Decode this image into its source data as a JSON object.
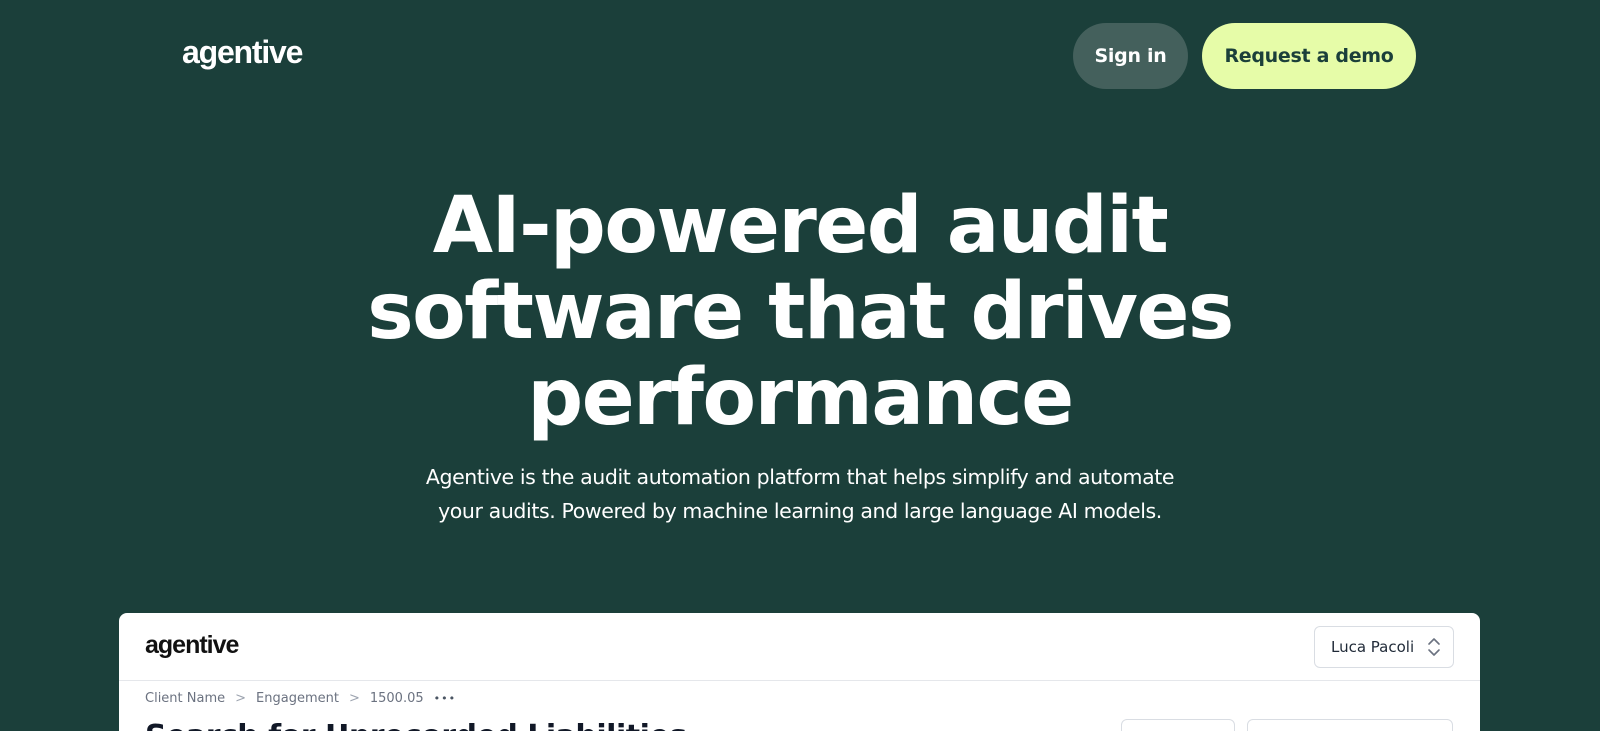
{
  "nav": {
    "logo": "agentive",
    "signin_label": "Sign in",
    "demo_label": "Request a demo"
  },
  "hero": {
    "title_line1": "AI-powered audit",
    "title_line2": "software that drives",
    "title_line3": "performance",
    "subtitle_line1": "Agentive is the audit automation platform that helps simplify and automate",
    "subtitle_line2": "your audits. Powered by machine learning and large language AI models."
  },
  "preview": {
    "logo": "agentive",
    "user": "Luca Pacoli",
    "breadcrumb": [
      "Client Name",
      "Engagement",
      "1500.05"
    ],
    "breadcrumb_sep": ">",
    "more": "•••",
    "title": "Search for Unrecorded Liabilities"
  },
  "colors": {
    "background": "#1b3f3a",
    "accent": "#e6fca8",
    "signin_bg": "#44605c"
  }
}
